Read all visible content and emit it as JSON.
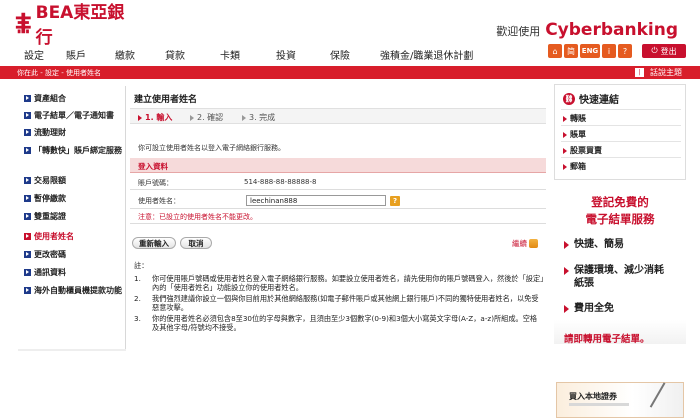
{
  "header": {
    "logo_text": "BEA東亞銀行",
    "welcome_text": "歡迎使用",
    "welcome_brand": "Cyberbanking"
  },
  "topnav": {
    "items": [
      "設定",
      "賬戶",
      "繳款",
      "貸款",
      "卡類",
      "投資",
      "保險",
      "強積金/職業退休計劃"
    ]
  },
  "toolbar": {
    "icons": [
      "home-icon",
      "simplified-chinese-icon",
      "english-icon",
      "print-icon",
      "help-icon"
    ],
    "labels": [
      "⌂",
      "简",
      "ENG",
      "i",
      "?"
    ],
    "logout_label": "登出"
  },
  "breadcrumb": {
    "text": "你在此 - 設定 - 使用者姓名",
    "right_label": "話說主題"
  },
  "sidebar": {
    "items": [
      {
        "label": "資產組合",
        "active": false
      },
      {
        "label": "電子結單／電子通知書",
        "active": false
      },
      {
        "label": "流動理財",
        "active": false
      },
      {
        "label": "「轉數快」賬戶綁定服務",
        "active": false
      },
      {
        "label": "交易限額",
        "active": false
      },
      {
        "label": "暫停繳款",
        "active": false
      },
      {
        "label": "雙重認證",
        "active": false
      },
      {
        "label": "使用者姓名",
        "active": true
      },
      {
        "label": "更改密碼",
        "active": false
      },
      {
        "label": "通訊資料",
        "active": false
      },
      {
        "label": "海外自動櫃員機提款功能",
        "active": false
      }
    ]
  },
  "main": {
    "title": "建立使用者姓名",
    "steps": [
      {
        "label": "1. 輸入",
        "active": true
      },
      {
        "label": "2. 確認",
        "active": false
      },
      {
        "label": "3. 完成",
        "active": false
      }
    ],
    "intro": "你可設立使用者姓名以登入電子網絡銀行服務。",
    "section_title": "登入資料",
    "account_label": "賬戶號碼：",
    "account_value": "514-888-88-88888-8",
    "username_label": "使用者姓名：",
    "username_value": "leechinan888",
    "warning": "注意：已設立的使用者姓名不能更改。",
    "reset_label": "重新輸入",
    "cancel_label": "取消",
    "continue_label": "繼續",
    "notes_heading": "註：",
    "notes": [
      {
        "num": "1.",
        "text": "你可使用賬戶號碼或使用者姓名登入電子網絡銀行服務。如要設立使用者姓名，請先使用你的賬戶號碼登入，然後於「設定」內的「使用者姓名」功能設立你的使用者姓名。"
      },
      {
        "num": "2.",
        "text": "我們強烈建議你設立一個與你目前用於其他網絡服務(如電子郵件賬戶或其他網上銀行賬戶)不同的獨特使用者姓名，以免受惡意攻擊。"
      },
      {
        "num": "3.",
        "text": "你的使用者姓名必須包含8至30位的字母與數字，且須由至少3個數字(0-9)和3個大小寫英文字母(A-Z，a-z)所組成。空格及其他字母/符號均不接受。"
      }
    ]
  },
  "quicklinks": {
    "title": "快速連結",
    "items": [
      "轉賬",
      "賬單",
      "股票買賣",
      "郵箱"
    ]
  },
  "promo": {
    "title_line1": "登記免費的",
    "title_line2": "電子結單服務",
    "bullets": [
      "快捷、簡易",
      "保護環境、減少消耗紙張",
      "費用全免"
    ],
    "link": "請即轉用電子結單。"
  },
  "banner": {
    "text": "買入本地證券"
  },
  "colors": {
    "brand_red": "#c8102e",
    "bar_red": "#d81e2b",
    "accent_orange": "#e55b20",
    "sidebar_bullet": "#1e3a8a"
  }
}
